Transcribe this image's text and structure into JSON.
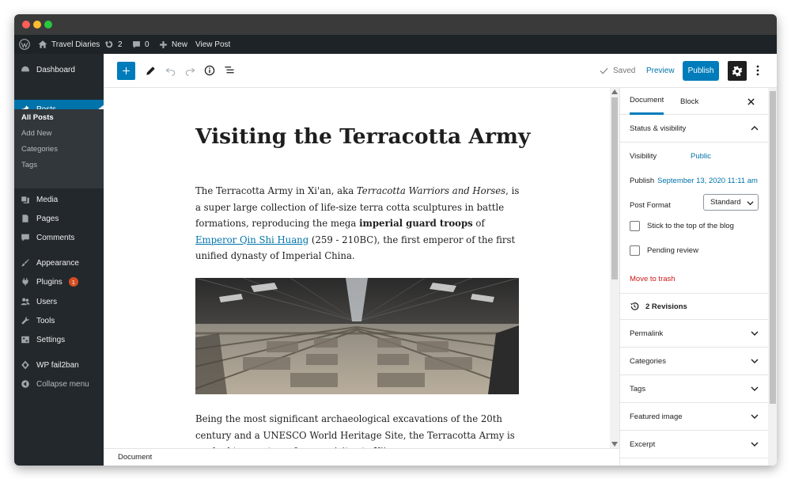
{
  "admin_bar": {
    "site_name": "Travel Diaries",
    "updates_count": "2",
    "comments_count": "0",
    "new_label": "New",
    "view_post_label": "View Post"
  },
  "sidebar": {
    "items": [
      {
        "label": "Dashboard",
        "icon": "dashboard-icon"
      },
      {
        "label": "Posts",
        "icon": "pin-icon"
      },
      {
        "label": "Media",
        "icon": "media-icon"
      },
      {
        "label": "Pages",
        "icon": "pages-icon"
      },
      {
        "label": "Comments",
        "icon": "comments-icon"
      },
      {
        "label": "Appearance",
        "icon": "brush-icon"
      },
      {
        "label": "Plugins",
        "icon": "plug-icon",
        "badge": "1"
      },
      {
        "label": "Users",
        "icon": "users-icon"
      },
      {
        "label": "Tools",
        "icon": "wrench-icon"
      },
      {
        "label": "Settings",
        "icon": "settings-icon"
      },
      {
        "label": "WP fail2ban",
        "icon": "shield-icon"
      },
      {
        "label": "Collapse menu",
        "icon": "collapse-icon"
      }
    ],
    "submenu": [
      "All Posts",
      "Add New",
      "Categories",
      "Tags"
    ]
  },
  "toolbar": {
    "saved_label": "Saved",
    "preview_label": "Preview",
    "publish_label": "Publish"
  },
  "post": {
    "title": "Visiting the Terracotta Army",
    "p1_a": "The Terracotta Army in Xi'an, aka ",
    "p1_em": "Terracotta Warriors and Horses",
    "p1_b": ", is a super large collection of life-size terra cotta sculptures in battle formations, reproducing the mega ",
    "p1_strong": "imperial guard troops",
    "p1_c": " of ",
    "p1_link": "Emperor Qin Shi Huang",
    "p1_d": " (259 - 210BC), the first emperor of the first unified dynasty of Imperial China.",
    "p2": "Being the most significant archaeological excavations of the 20th century and a UNESCO World Heritage Site, the Terracotta Army is no doubt a must-see for any visitor to Xi'an."
  },
  "footer": {
    "breadcrumb": "Document"
  },
  "panel": {
    "tab_document": "Document",
    "tab_block": "Block",
    "status_heading": "Status & visibility",
    "visibility_label": "Visibility",
    "visibility_value": "Public",
    "publish_label": "Publish",
    "publish_date": "September 13, 2020 11:11 am",
    "post_format_label": "Post Format",
    "post_format_value": "Standard",
    "sticky_label": "Stick to the top of the blog",
    "pending_label": "Pending review",
    "trash_label": "Move to trash",
    "revisions_label": "2 Revisions",
    "sections": [
      "Permalink",
      "Categories",
      "Tags",
      "Featured image",
      "Excerpt"
    ]
  },
  "colors": {
    "accent": "#0073aa",
    "admin_bar_bg": "#1d2327",
    "sidebar_bg": "#23282d",
    "trash_red": "#cc1818"
  }
}
